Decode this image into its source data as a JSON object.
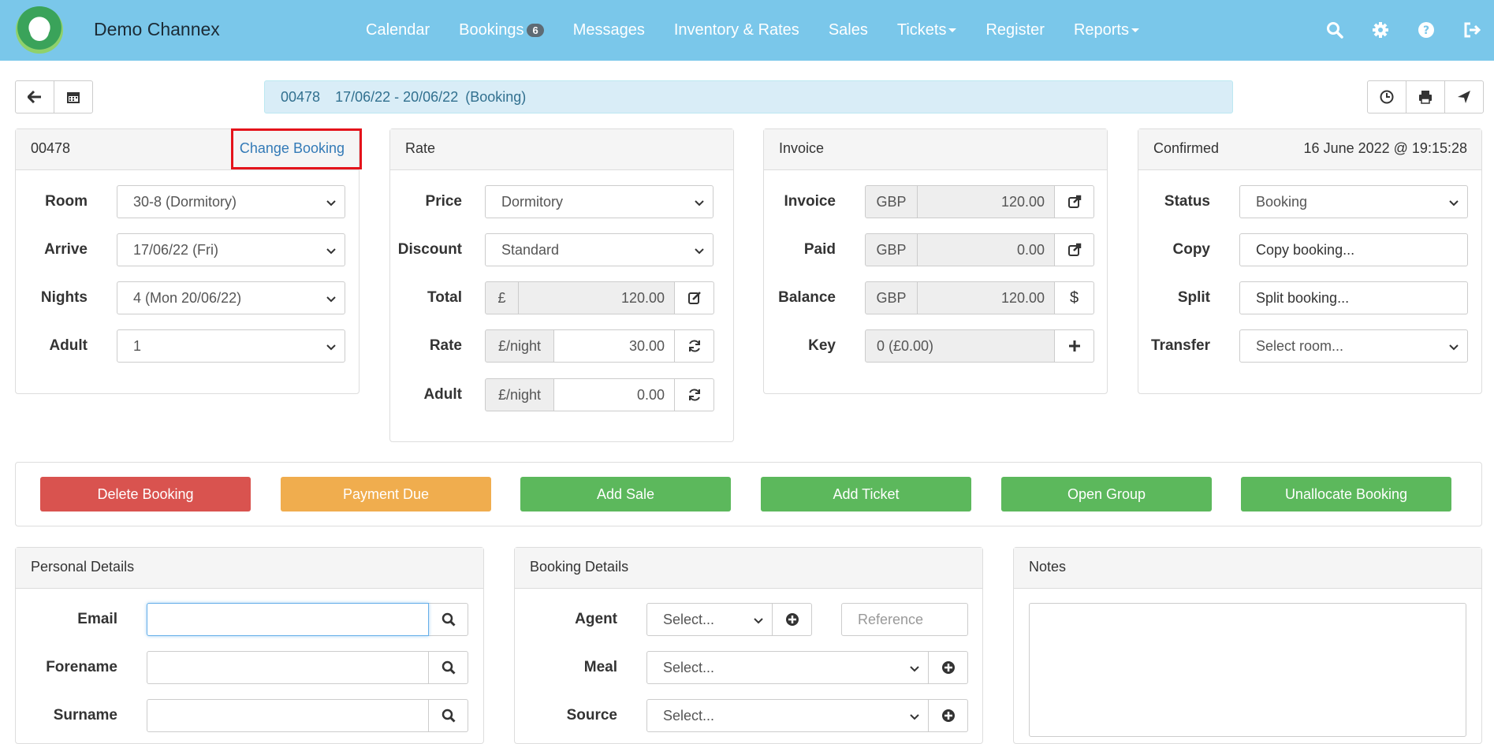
{
  "nav": {
    "brand": "Demo Channex",
    "links": [
      "Calendar",
      "Bookings",
      "Messages",
      "Inventory & Rates",
      "Sales",
      "Tickets",
      "Register",
      "Reports"
    ],
    "bookings_badge": "6"
  },
  "header": {
    "booking_id": "00478",
    "dates": "17/06/22 - 20/06/22",
    "type": "(Booking)"
  },
  "booking_panel": {
    "id": "00478",
    "change_link": "Change Booking",
    "labels": {
      "room": "Room",
      "arrive": "Arrive",
      "nights": "Nights",
      "adult": "Adult"
    },
    "room": "30-8 (Dormitory)",
    "arrive": "17/06/22  (Fri)",
    "nights": "4  (Mon 20/06/22)",
    "adult": "1"
  },
  "rate_panel": {
    "title": "Rate",
    "labels": {
      "price": "Price",
      "discount": "Discount",
      "total": "Total",
      "rate": "Rate",
      "adult": "Adult"
    },
    "price": "Dormitory",
    "discount": "Standard",
    "total_currency": "£",
    "total": "120.00",
    "rate_unit": "£/night",
    "rate": "30.00",
    "adult_unit": "£/night",
    "adult": "0.00"
  },
  "invoice_panel": {
    "title": "Invoice",
    "labels": {
      "invoice": "Invoice",
      "paid": "Paid",
      "balance": "Balance",
      "key": "Key"
    },
    "currency": "GBP",
    "invoice": "120.00",
    "paid": "0.00",
    "balance": "120.00",
    "balance_symbol": "$",
    "key": "0 (£0.00)"
  },
  "status_panel": {
    "title": "Confirmed",
    "timestamp": "16 June 2022 @ 19:15:28",
    "labels": {
      "status": "Status",
      "copy": "Copy",
      "split": "Split",
      "transfer": "Transfer"
    },
    "status": "Booking",
    "copy": "Copy booking...",
    "split": "Split booking...",
    "transfer": "Select room..."
  },
  "actions": {
    "delete": "Delete Booking",
    "payment_due": "Payment Due",
    "add_sale": "Add Sale",
    "add_ticket": "Add Ticket",
    "open_group": "Open Group",
    "unallocate": "Unallocate Booking"
  },
  "colors": {
    "nav": "#7ac7ea",
    "danger": "#d9534f",
    "warning": "#f0ad4e",
    "success": "#5cb85c"
  },
  "personal_panel": {
    "title": "Personal Details",
    "labels": {
      "email": "Email",
      "forename": "Forename",
      "surname": "Surname"
    },
    "email": "",
    "forename": "",
    "surname": ""
  },
  "booking_details_panel": {
    "title": "Booking Details",
    "labels": {
      "agent": "Agent",
      "meal": "Meal",
      "source": "Source"
    },
    "agent": "Select...",
    "reference_placeholder": "Reference",
    "meal": "Select...",
    "source": "Select..."
  },
  "notes_panel": {
    "title": "Notes"
  }
}
